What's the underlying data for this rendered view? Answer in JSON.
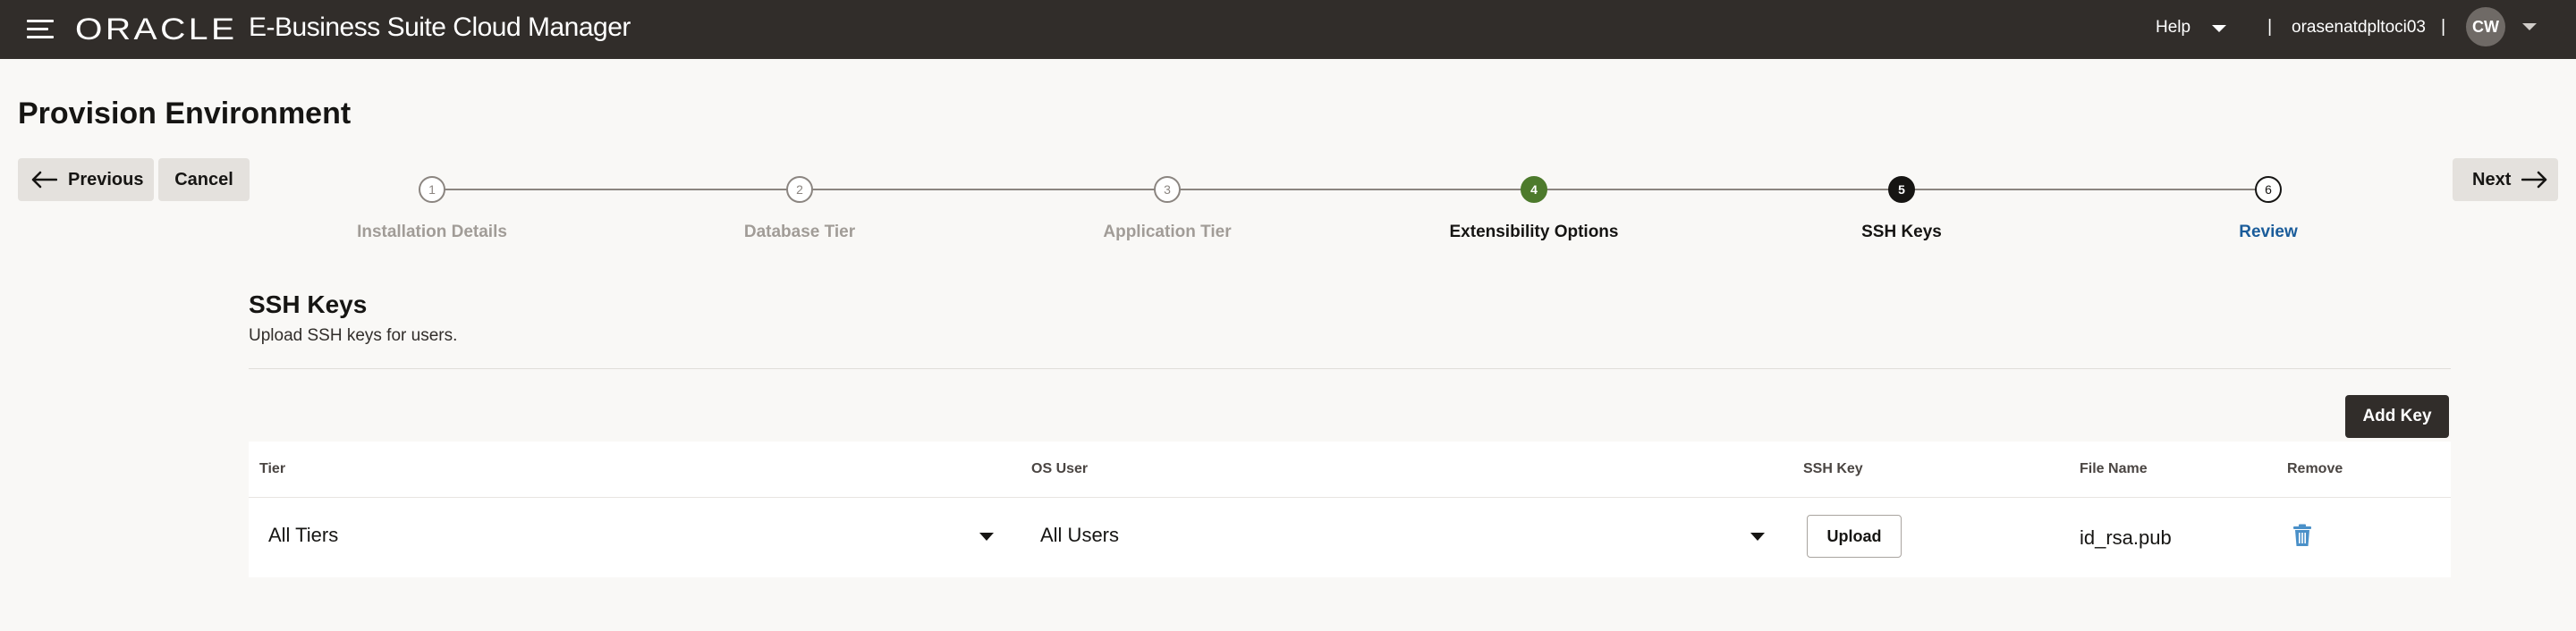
{
  "header": {
    "logo": "ORACLE",
    "product": "E-Business Suite Cloud Manager",
    "help_label": "Help",
    "separator": "|",
    "username": "orasenatdpltoci03",
    "avatar_initials": "CW"
  },
  "page": {
    "title": "Provision Environment"
  },
  "nav": {
    "previous_label": "Previous",
    "cancel_label": "Cancel",
    "next_label": "Next"
  },
  "train": {
    "steps": [
      {
        "number": "1",
        "label": "Installation Details",
        "state": "todo"
      },
      {
        "number": "2",
        "label": "Database Tier",
        "state": "todo"
      },
      {
        "number": "3",
        "label": "Application Tier",
        "state": "todo"
      },
      {
        "number": "4",
        "label": "Extensibility Options",
        "state": "done"
      },
      {
        "number": "5",
        "label": "SSH Keys",
        "state": "current"
      },
      {
        "number": "6",
        "label": "Review",
        "state": "next"
      }
    ]
  },
  "section": {
    "title": "SSH Keys",
    "subtitle": "Upload SSH keys for users.",
    "add_key_label": "Add Key"
  },
  "table": {
    "columns": [
      "Tier",
      "OS User",
      "SSH Key",
      "File Name",
      "Remove"
    ],
    "rows": [
      {
        "tier": "All Tiers",
        "os_user": "All Users",
        "ssh_key_button": "Upload",
        "file_name": "id_rsa.pub",
        "remove_icon": "trash-icon"
      }
    ]
  },
  "colors": {
    "header_bg": "#312d2a",
    "step_done": "#4d7a2c",
    "step_current": "#161513",
    "link": "#1a5c9a",
    "trash_icon": "#4a90c8"
  }
}
